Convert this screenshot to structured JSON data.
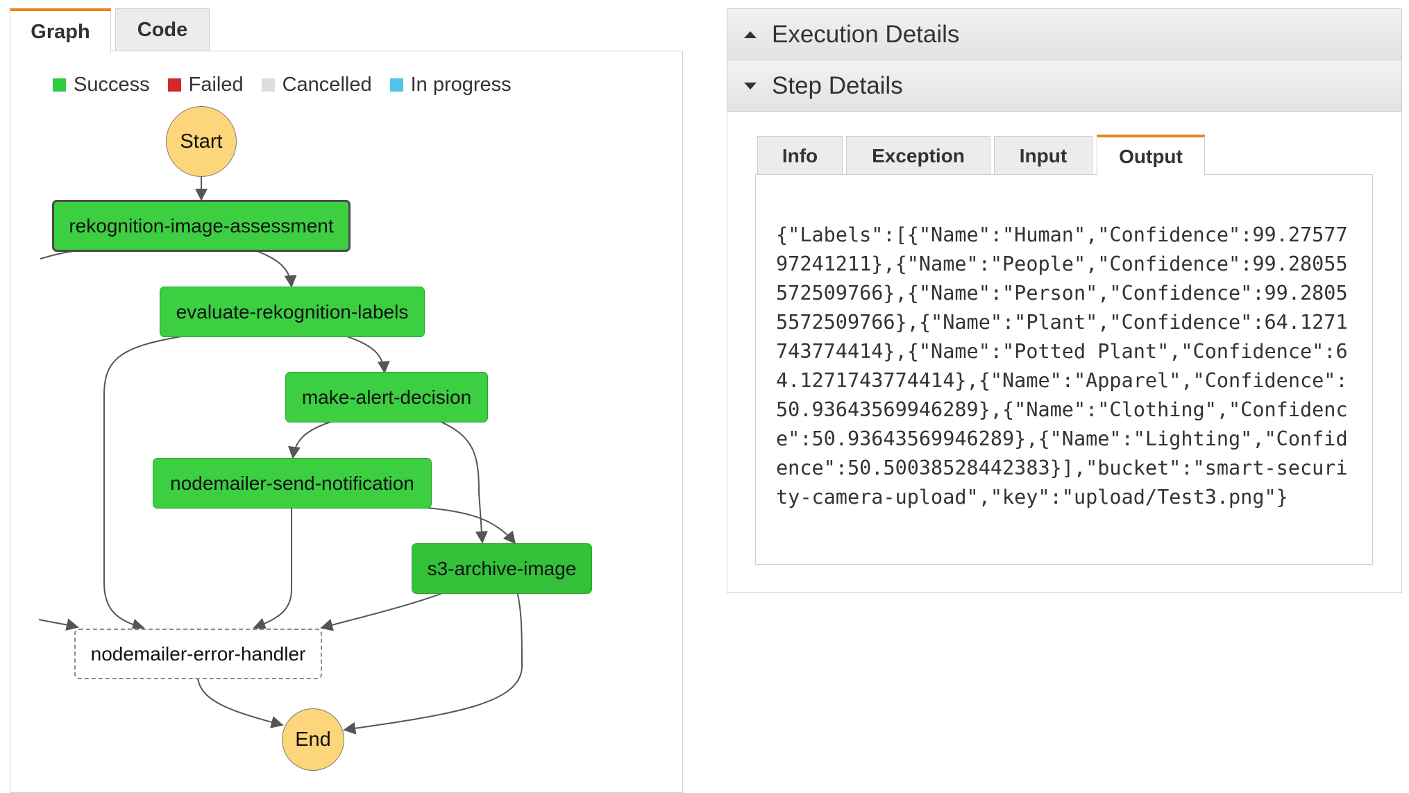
{
  "graph_tabs": {
    "graph": "Graph",
    "code": "Code"
  },
  "legend": [
    {
      "label": "Success",
      "color": "#2ecc40"
    },
    {
      "label": "Failed",
      "color": "#d9262c"
    },
    {
      "label": "Cancelled",
      "color": "#dddddd"
    },
    {
      "label": "In progress",
      "color": "#4fc3e8"
    }
  ],
  "states": {
    "start": "Start",
    "rekognition_image_assessment": "rekognition-image-assessment",
    "evaluate_rekognition_labels": "evaluate-rekognition-labels",
    "make_alert_decision": "make-alert-decision",
    "nodemailer_send_notification": "nodemailer-send-notification",
    "s3_archive_image": "s3-archive-image",
    "nodemailer_error_handler": "nodemailer-error-handler",
    "end": "End"
  },
  "execution_details": {
    "title": "Execution Details"
  },
  "step_details": {
    "title": "Step Details",
    "tabs": {
      "info": "Info",
      "exception": "Exception",
      "input": "Input",
      "output": "Output"
    },
    "active_tab": "Output",
    "output": "{\"Labels\":[{\"Name\":\"Human\",\"Confidence\":99.2757797241211},{\"Name\":\"People\",\"Confidence\":99.28055572509766},{\"Name\":\"Person\",\"Confidence\":99.28055572509766},{\"Name\":\"Plant\",\"Confidence\":64.1271743774414},{\"Name\":\"Potted Plant\",\"Confidence\":64.1271743774414},{\"Name\":\"Apparel\",\"Confidence\":50.93643569946289},{\"Name\":\"Clothing\",\"Confidence\":50.93643569946289},{\"Name\":\"Lighting\",\"Confidence\":50.50038528442383}],\"bucket\":\"smart-security-camera-upload\",\"key\":\"upload/Test3.png\"}"
  }
}
